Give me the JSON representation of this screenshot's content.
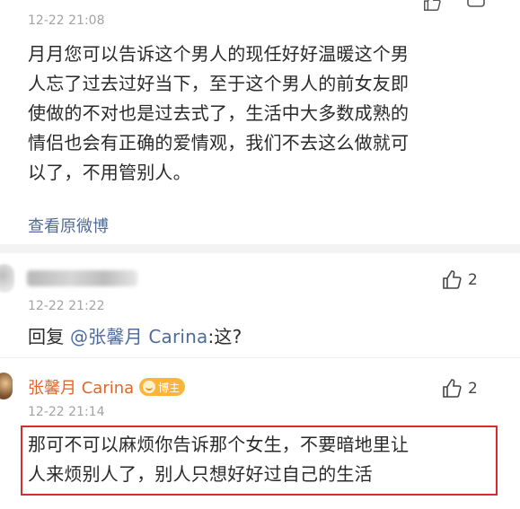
{
  "comment1": {
    "timestamp": "12-22 21:08",
    "lines": [
      "月月您可以告诉这个男人的现任好好温暖这个男",
      "人忘了过去过好当下，至于这个男人的前女友即",
      "使做的不对也是过去式了，生活中大多数成熟的",
      "情侣也会有正确的爱情观，我们不去这么做就可",
      "以了，不用管别人。"
    ],
    "view_original": "查看原微博"
  },
  "comment2": {
    "likes": "2",
    "timestamp": "12-22 21:22",
    "reply_prefix": "回复",
    "mention": "@张馨月 Carina",
    "reply_rest": ":这?"
  },
  "comment3": {
    "author": "张馨月 Carina",
    "badge": "博主",
    "likes": "2",
    "timestamp": "12-22 21:14",
    "lines": [
      "那可不可以麻烦你告诉那个女生，不要暗地里让",
      "人来烦别人了，别人只想好好过自己的生活"
    ]
  },
  "colors": {
    "author": "#e0672a",
    "mention": "#4d6b9b",
    "highlight_border": "#d32d2d",
    "badge": "#ffb33a"
  }
}
